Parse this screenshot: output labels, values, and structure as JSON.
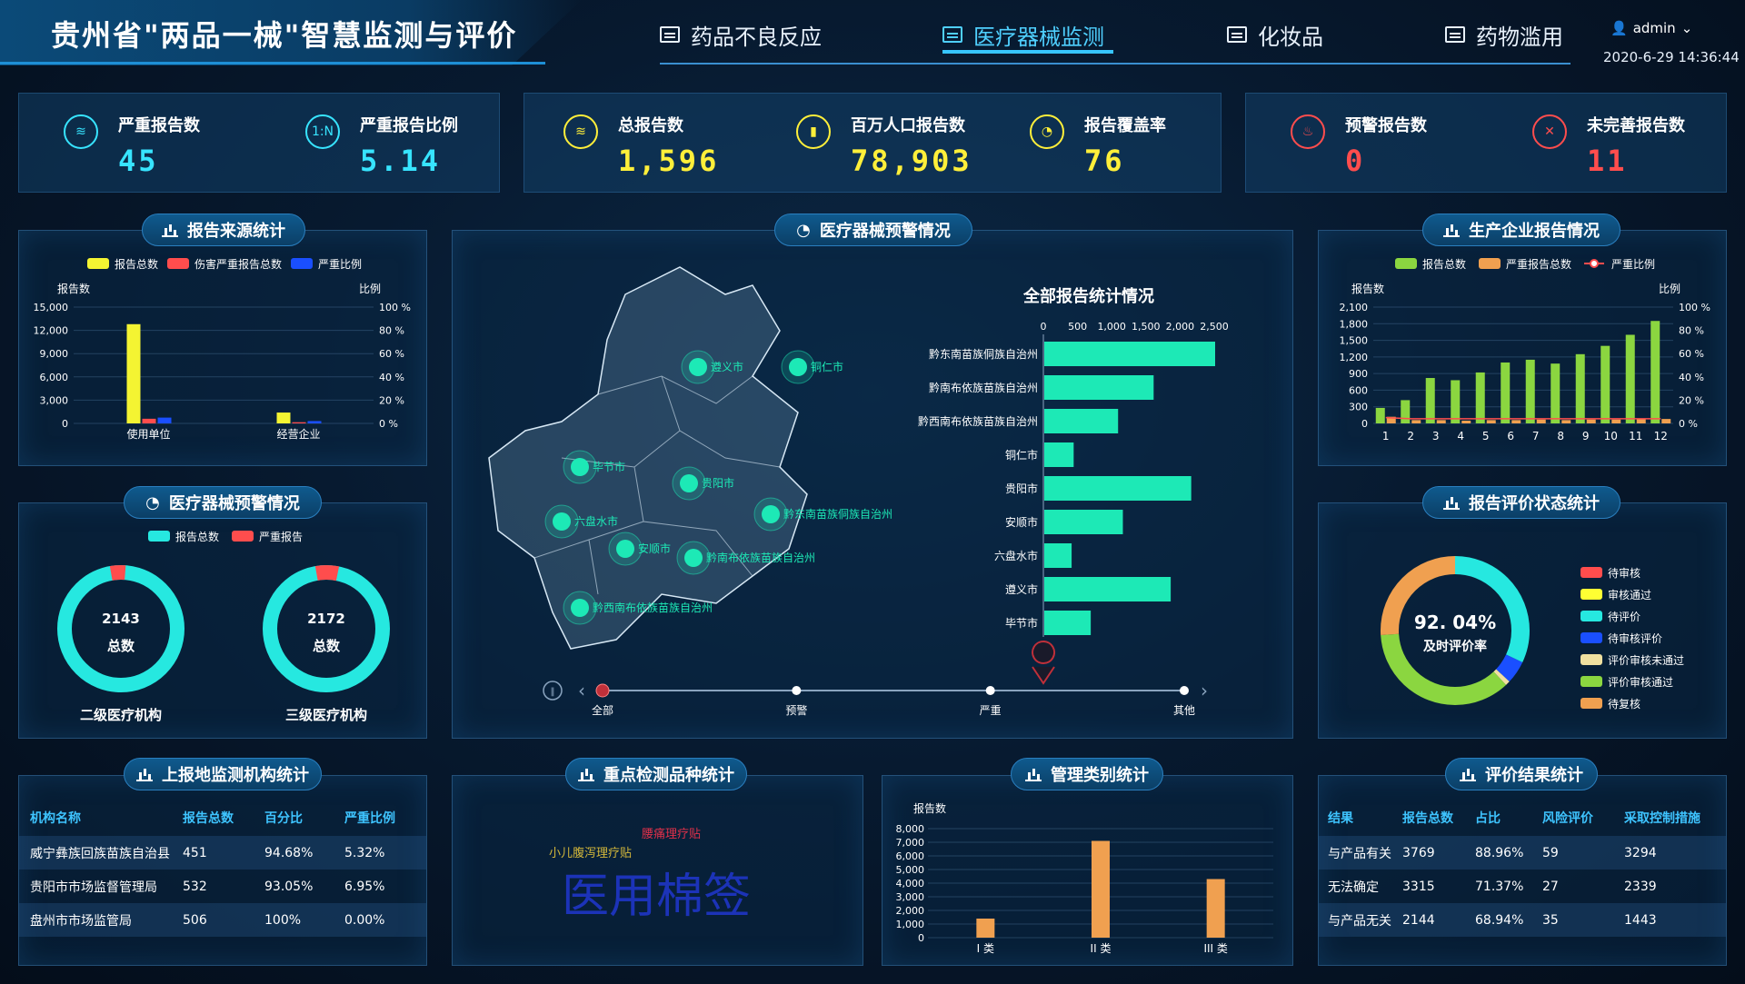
{
  "header": {
    "title": "贵州省\"两品一械\"智慧监测与评价",
    "nav": [
      {
        "label": "药品不良反应",
        "active": false
      },
      {
        "label": "医疗器械监测",
        "active": true
      },
      {
        "label": "化妆品",
        "active": false
      },
      {
        "label": "药物滥用",
        "active": false
      }
    ],
    "user": "admin",
    "datetime": "2020-6-29 14:36:44"
  },
  "kpis": [
    {
      "label": "严重报告数",
      "value": "45",
      "color": "#37e4ff",
      "icon": "database-icon",
      "glyph": "≋"
    },
    {
      "label": "严重报告比例",
      "value": "5.14",
      "color": "#37e4ff",
      "icon": "ratio-icon",
      "glyph": "1:N"
    },
    {
      "label": "总报告数",
      "value": "1,596",
      "color": "#ffef3a",
      "icon": "coins-icon",
      "glyph": "≋"
    },
    {
      "label": "百万人口报告数",
      "value": "78,903",
      "color": "#ffef3a",
      "icon": "bar-chart-icon",
      "glyph": "▮"
    },
    {
      "label": "报告覆盖率",
      "value": "76",
      "color": "#ffef3a",
      "icon": "pie-chart-icon",
      "glyph": "◔"
    },
    {
      "label": "预警报告数",
      "value": "0",
      "color": "#ff4d4d",
      "icon": "alarm-icon",
      "glyph": "♨"
    },
    {
      "label": "未完善报告数",
      "value": "11",
      "color": "#ff4d4d",
      "icon": "close-circle-icon",
      "glyph": "✕"
    }
  ],
  "panels": {
    "source": "报告来源统计",
    "warning_left": "医疗器械预警情况",
    "map": "医疗器械预警情况",
    "enterprise": "生产企业报告情况",
    "eval_status": "报告评价状态统计",
    "institution": "上报地监测机构统计",
    "keyproduct": "重点检测品种统计",
    "category": "管理类别统计",
    "result": "评价结果统计"
  },
  "source_chart": {
    "legend": [
      "报告总数",
      "伤害严重报告总数",
      "严重比例"
    ],
    "colors": [
      "#f4f432",
      "#ff4d4d",
      "#1a4fff"
    ],
    "ylabel_left": "报告数",
    "ylabel_right": "比例",
    "left_ticks": [
      "15,000",
      "12,000",
      "9,000",
      "6,000",
      "3,000",
      "0"
    ],
    "right_ticks": [
      "100 %",
      "80 %",
      "60 %",
      "40 %",
      "20 %",
      "0 %"
    ],
    "categories": [
      "使用单位",
      "经营企业"
    ],
    "series": [
      {
        "name": "报告总数",
        "values": [
          12800,
          1400
        ]
      },
      {
        "name": "伤害严重报告总数",
        "values": [
          600,
          150
        ]
      },
      {
        "name": "严重比例",
        "values": [
          5,
          2
        ]
      }
    ],
    "ylim": [
      0,
      15000
    ]
  },
  "warning_donuts": {
    "legend": [
      "报告总数",
      "严重报告"
    ],
    "colors": [
      "#26e8e0",
      "#ff4d4d"
    ],
    "items": [
      {
        "value": "2143",
        "caption": "总数",
        "label": "二级医疗机构",
        "severe_ratio": 0.04
      },
      {
        "value": "2172",
        "caption": "总数",
        "label": "三级医疗机构",
        "severe_ratio": 0.06
      }
    ]
  },
  "map": {
    "cities": [
      "遵义市",
      "铜仁市",
      "毕节市",
      "贵阳市",
      "黔东南苗族侗族自治州",
      "六盘水市",
      "安顺市",
      "黔南布依族苗族自治州",
      "黔西南布依族苗族自治州"
    ],
    "timeline": [
      "全部",
      "预警",
      "严重",
      "其他"
    ],
    "bar_title": "全部报告统计情况",
    "bar_ticks": [
      "0",
      "500",
      "1,000",
      "1,500",
      "2,000",
      "2,500"
    ],
    "bar_tick_values": [
      0,
      500,
      1000,
      1500,
      2000,
      2500
    ],
    "bar_categories": [
      "黔东南苗族侗族自治州",
      "黔南布依族苗族自治州",
      "黔西南布依族苗族自治州",
      "铜仁市",
      "贵阳市",
      "安顺市",
      "六盘水市",
      "遵义市",
      "毕节市"
    ],
    "bar_values": [
      2500,
      1600,
      1080,
      430,
      2150,
      1150,
      400,
      1850,
      680
    ],
    "bar_max": 2500,
    "color": "#1de9b6"
  },
  "enterprise_chart": {
    "legend": [
      "报告总数",
      "严重报告总数",
      "严重比例"
    ],
    "colors": [
      "#8bd640",
      "#f0a050",
      "#ff4d4d"
    ],
    "ylabel_left": "报告数",
    "ylabel_right": "比例",
    "left_ticks": [
      "2,100",
      "1,800",
      "1,500",
      "1,200",
      "900",
      "600",
      "300",
      "0"
    ],
    "right_ticks": [
      "100 %",
      "80 %",
      "60 %",
      "40 %",
      "20 %",
      "0 %"
    ],
    "categories": [
      "1",
      "2",
      "3",
      "4",
      "5",
      "6",
      "7",
      "8",
      "9",
      "10",
      "11",
      "12"
    ],
    "series": [
      {
        "name": "报告总数",
        "values": [
          280,
          420,
          820,
          780,
          920,
          1100,
          1150,
          1080,
          1250,
          1400,
          1600,
          1850
        ]
      },
      {
        "name": "严重报告总数",
        "values": [
          120,
          60,
          60,
          50,
          60,
          60,
          70,
          60,
          70,
          70,
          80,
          80
        ]
      },
      {
        "name": "严重比例",
        "values": [
          5,
          4,
          4,
          4,
          4,
          4,
          4,
          4,
          4,
          4,
          4,
          4
        ]
      }
    ],
    "ylim": [
      0,
      2100
    ]
  },
  "eval_status": {
    "center_value": "92. 04%",
    "center_label": "及时评价率",
    "legend": [
      "待审核",
      "审核通过",
      "待评价",
      "待审核评价",
      "评价审核未通过",
      "评价审核通过",
      "待复核"
    ],
    "colors": [
      "#ff4d4d",
      "#ffff33",
      "#26e8e0",
      "#1a4fff",
      "#f0e0a0",
      "#8bd640",
      "#f0a050"
    ],
    "values": [
      0,
      0,
      32,
      5,
      1,
      36,
      26
    ]
  },
  "institution": {
    "headers": [
      "机构名称",
      "报告总数",
      "百分比",
      "严重比例"
    ],
    "rows": [
      [
        "威宁彝族回族苗族自治县",
        "451",
        "94.68%",
        "5.32%"
      ],
      [
        "贵阳市市场监督管理局",
        "532",
        "93.05%",
        "6.95%"
      ],
      [
        "盘州市市场监管局",
        "506",
        "100%",
        "0.00%"
      ]
    ]
  },
  "keyproduct": {
    "words": [
      {
        "text": "腰痛理疗贴",
        "color": "#e2304a"
      },
      {
        "text": "小儿腹泻理疗贴",
        "color": "#d4b83a"
      },
      {
        "text": "医用棉签",
        "color": "#1c33b8"
      }
    ]
  },
  "category_chart": {
    "ylabel": "报告数",
    "ticks": [
      "8,000",
      "7,000",
      "6,000",
      "5,000",
      "4,000",
      "3,000",
      "2,000",
      "1,000",
      "0"
    ],
    "categories": [
      "I 类",
      "II 类",
      "III 类"
    ],
    "values": [
      1400,
      7100,
      4300
    ],
    "ylim": [
      0,
      8000
    ],
    "color": "#f0a050"
  },
  "result": {
    "headers": [
      "结果",
      "报告总数",
      "占比",
      "风险评价",
      "采取控制措施"
    ],
    "rows": [
      [
        "与产品有关",
        "3769",
        "88.96%",
        "59",
        "3294"
      ],
      [
        "无法确定",
        "3315",
        "71.37%",
        "27",
        "2339"
      ],
      [
        "与产品无关",
        "2144",
        "68.94%",
        "35",
        "1443"
      ]
    ]
  }
}
